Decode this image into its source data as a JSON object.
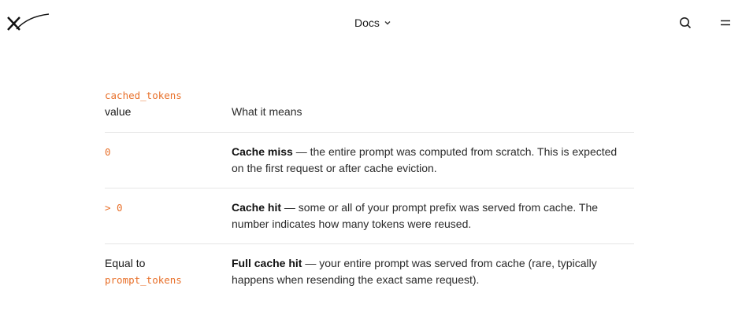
{
  "nav": {
    "docs_label": "Docs"
  },
  "table": {
    "header": {
      "col1_code": "cached_tokens",
      "col1_text": "value",
      "col2": "What it means"
    },
    "rows": [
      {
        "value_code": "0",
        "value_text": "",
        "title": "Cache miss",
        "description": " — the entire prompt was computed from scratch. This is expected on the first request or after cache eviction."
      },
      {
        "value_code": "> 0",
        "value_text": "",
        "title": "Cache hit",
        "description": " — some or all of your prompt prefix was served from cache. The number indicates how many tokens were reused."
      },
      {
        "value_code": "prompt_tokens",
        "value_text": "Equal to",
        "title": "Full cache hit",
        "description": " — your entire prompt was served from cache (rare, typically happens when resending the exact same request)."
      }
    ]
  },
  "icons": {
    "logo": "x-logo-icon",
    "chevron": "chevron-down-icon",
    "search": "search-icon",
    "menu": "menu-icon"
  },
  "colors": {
    "code": "#e8702a",
    "divider": "#e6e6e6",
    "text": "#1a1a1a"
  }
}
